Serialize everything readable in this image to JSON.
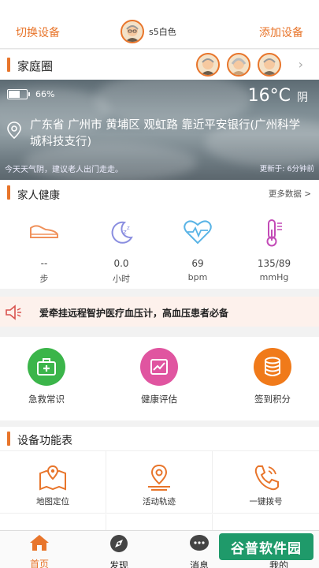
{
  "topbar": {
    "switch_device": "切换设备",
    "device_name": "s5白色",
    "add_device": "添加设备"
  },
  "family": {
    "title": "家庭圈",
    "chevron": "›",
    "member_count": 3
  },
  "weather": {
    "battery_level": 0.66,
    "battery_pct": "66%",
    "temperature": "16°C",
    "condition": "阴",
    "address": "广东省 广州市 黄埔区 观虹路 靠近平安银行(广州科学城科技支行)",
    "tip": "今天天气阴，建议老人出门走走。",
    "updated": "更新于: 6分钟前"
  },
  "health": {
    "title": "家人健康",
    "more": "更多数据 >",
    "metrics": [
      {
        "value": "--",
        "unit": "步",
        "icon": "shoe-icon"
      },
      {
        "value": "0.0",
        "unit": "小时",
        "icon": "moon-sleep-icon"
      },
      {
        "value": "69",
        "unit": "bpm",
        "icon": "heart-rate-icon"
      },
      {
        "value": "135/89",
        "unit": "mmHg",
        "icon": "thermometer-icon"
      }
    ]
  },
  "banner": {
    "text": "爱牵挂远程智护医疗血压计，高血压患者必备"
  },
  "quick": [
    {
      "label": "急救常识",
      "color": "#3bb54a",
      "icon": "first-aid-icon"
    },
    {
      "label": "健康评估",
      "color": "#e055a0",
      "icon": "chart-icon"
    },
    {
      "label": "签到积分",
      "color": "#f07a1a",
      "icon": "coins-icon"
    }
  ],
  "device": {
    "title": "设备功能表",
    "items": [
      {
        "label": "地图定位",
        "icon": "map-icon"
      },
      {
        "label": "活动轨迹",
        "icon": "location-pin-icon"
      },
      {
        "label": "一键拨号",
        "icon": "phone-icon"
      }
    ]
  },
  "tabs": [
    {
      "label": "首页",
      "icon": "home-icon",
      "active": true
    },
    {
      "label": "发现",
      "icon": "compass-icon",
      "active": false
    },
    {
      "label": "消息",
      "icon": "message-icon",
      "active": false
    },
    {
      "label": "我的",
      "icon": "user-icon",
      "active": false
    }
  ],
  "watermark": "谷普软件园",
  "colors": {
    "accent": "#e8752b",
    "green": "#3bb54a",
    "pink": "#e055a0",
    "orange": "#f07a1a"
  }
}
